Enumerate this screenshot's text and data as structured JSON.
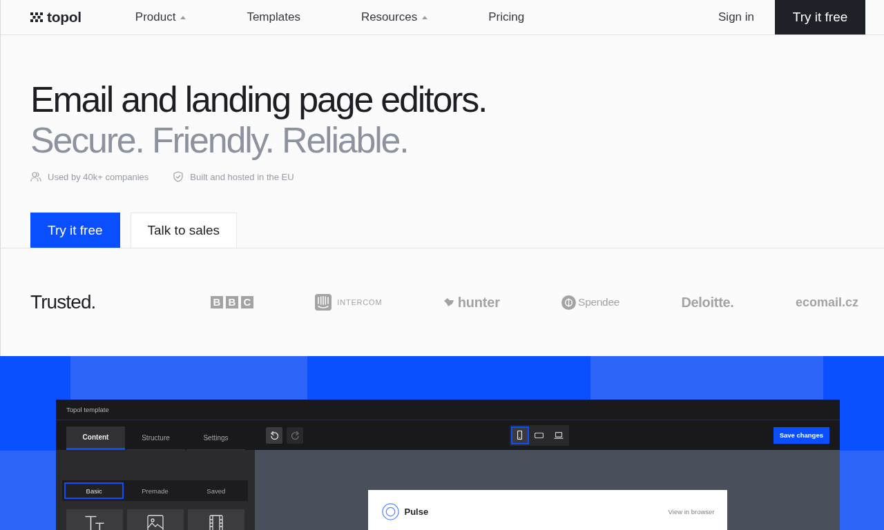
{
  "nav": {
    "logo": "topol",
    "items": [
      {
        "label": "Product",
        "has_menu": true
      },
      {
        "label": "Templates",
        "has_menu": false
      },
      {
        "label": "Resources",
        "has_menu": true
      },
      {
        "label": "Pricing",
        "has_menu": false
      }
    ],
    "sign_in": "Sign in",
    "cta": "Try it free"
  },
  "hero": {
    "title": "Email and landing page editors.",
    "subtitle": "Secure. Friendly. Reliable.",
    "facts": [
      {
        "kind": "users",
        "text": "Used by 40k+ companies"
      },
      {
        "kind": "shield",
        "text": "Built and hosted in the EU"
      }
    ],
    "buttons": [
      {
        "kind": "primary",
        "label": "Try it free"
      },
      {
        "kind": "secondary",
        "label": "Talk to sales"
      }
    ]
  },
  "trusted": {
    "heading": "Trusted.",
    "logos": [
      {
        "kind": "boxed",
        "text": "B B C"
      },
      {
        "kind": "intercom",
        "text": "INTERCOM"
      },
      {
        "kind": "hunter",
        "text": "hunter"
      },
      {
        "kind": "spendee",
        "text": "Spendee"
      },
      {
        "kind": "heavy",
        "text": "Deloitte."
      },
      {
        "kind": "wordmark",
        "text": "ecomail.cz"
      }
    ]
  },
  "editor": {
    "title": "Topol template",
    "tabs": [
      {
        "label": "Content",
        "selected": true
      },
      {
        "label": "Structure",
        "selected": false
      },
      {
        "label": "Settings",
        "selected": false
      }
    ],
    "subtabs": [
      {
        "label": "Basic",
        "selected": true
      },
      {
        "label": "Premade",
        "selected": false
      },
      {
        "label": "Saved",
        "selected": false
      }
    ],
    "history": [
      {
        "kind": "undo",
        "disabled": false
      },
      {
        "kind": "redo",
        "disabled": true
      }
    ],
    "devices": [
      {
        "kind": "mobile",
        "selected": true
      },
      {
        "kind": "tablet",
        "selected": false
      },
      {
        "kind": "desktop",
        "selected": false
      }
    ],
    "save": "Save changes",
    "blocks": [
      {
        "kind": "text"
      },
      {
        "kind": "image"
      },
      {
        "kind": "video"
      }
    ],
    "preview": {
      "brand": "Pulse",
      "link": "View in browser"
    }
  }
}
